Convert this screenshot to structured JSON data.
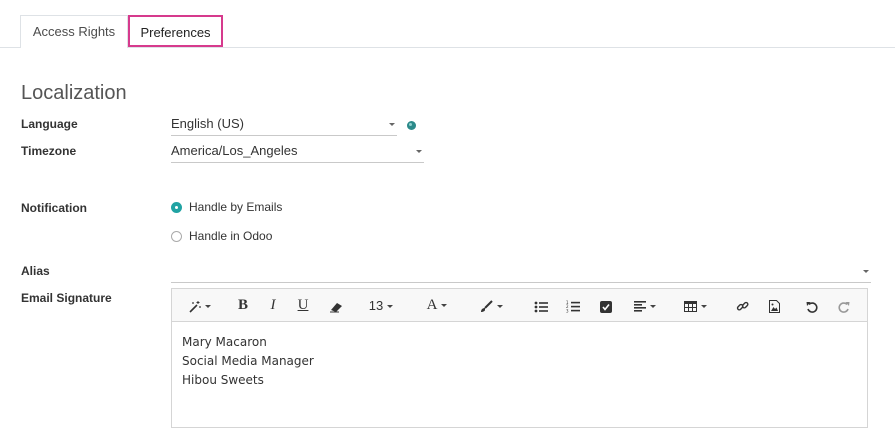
{
  "tabs": {
    "access_rights": "Access Rights",
    "preferences": "Preferences"
  },
  "section": {
    "title": "Localization"
  },
  "fields": {
    "language": {
      "label": "Language",
      "value": "English (US)"
    },
    "timezone": {
      "label": "Timezone",
      "value": "America/Los_Angeles"
    },
    "notification": {
      "label": "Notification",
      "options": [
        "Handle by Emails",
        "Handle in Odoo"
      ],
      "selected": "Handle by Emails"
    },
    "alias": {
      "label": "Alias",
      "value": ""
    },
    "signature": {
      "label": "Email Signature",
      "lines": [
        "Mary Macaron",
        "Social Media Manager",
        "Hibou Sweets"
      ]
    }
  },
  "toolbar": {
    "font_size": "13"
  },
  "colors": {
    "accent": "#21a3a3",
    "tab_highlight": "#d63a8d"
  }
}
